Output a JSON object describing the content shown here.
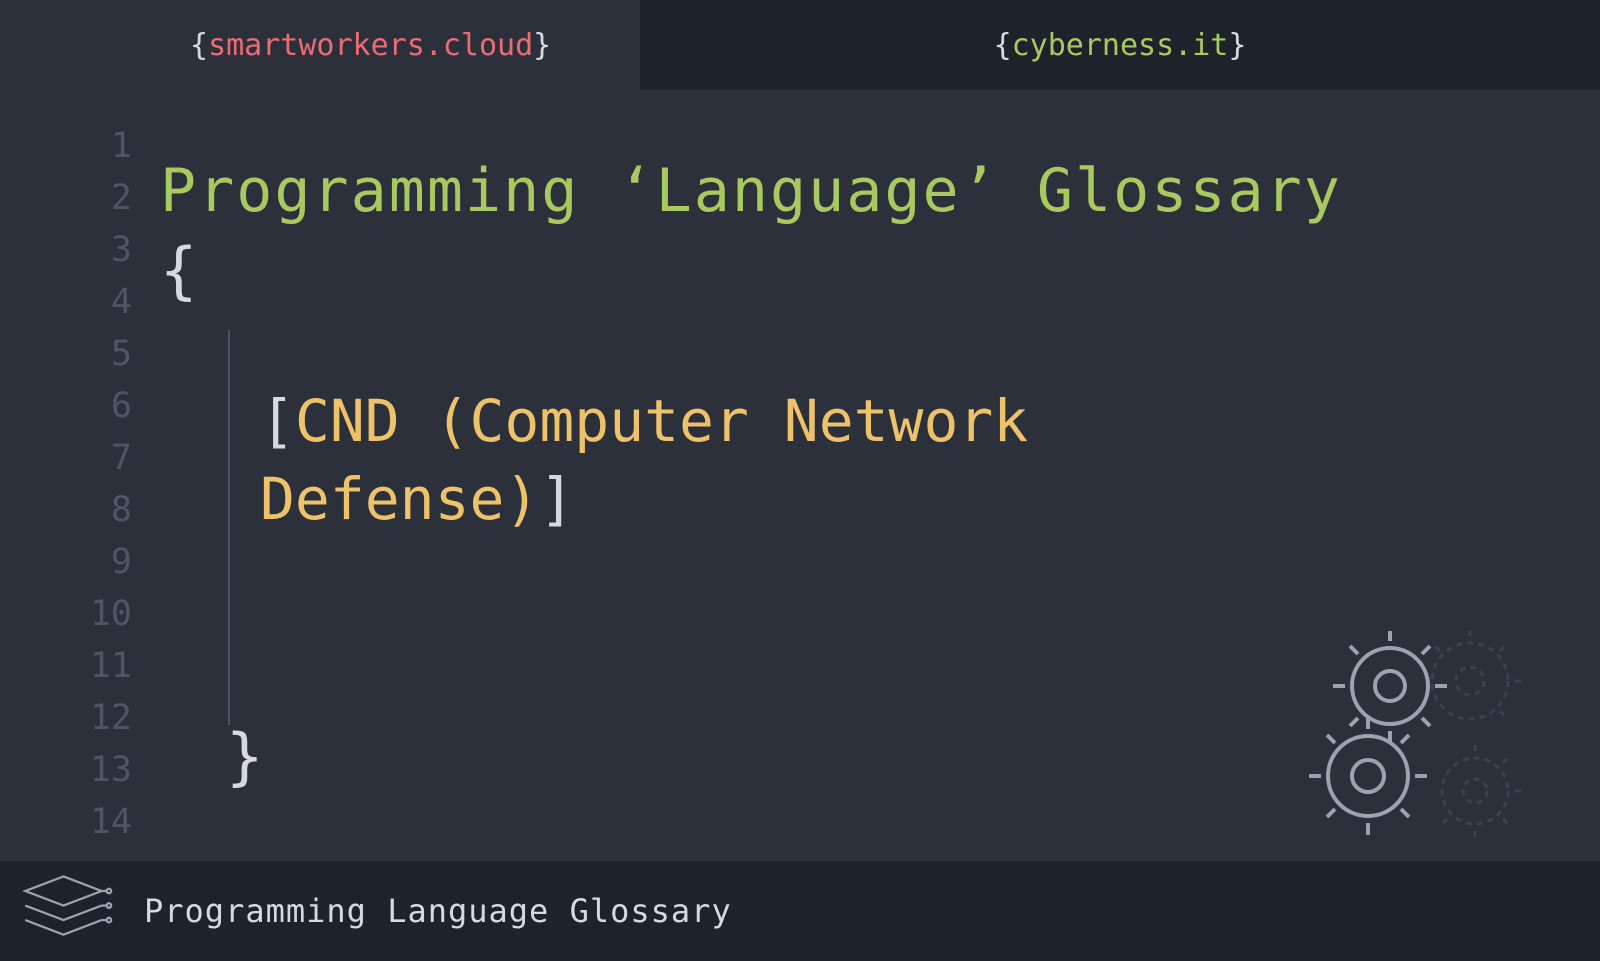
{
  "header": {
    "left_brand": "smartworkers.cloud",
    "right_brand": "cyberness.it",
    "brace_open": "{",
    "brace_close": "}"
  },
  "gutter": {
    "line_count": 14
  },
  "editor": {
    "title": "Programming ‘Language’ Glossary",
    "brace_open": "{",
    "brace_close": "}",
    "bracket_open": "[",
    "bracket_close": "]",
    "term": "CND (Computer Network Defense)"
  },
  "footer": {
    "text": "Programming Language Glossary"
  },
  "colors": {
    "bg": "#2b303b",
    "dark_bg": "#1e222b",
    "green": "#a8c95f",
    "red": "#ec6b75",
    "yellow": "#eec26a",
    "muted": "#4e5564",
    "white": "#d6dae0"
  }
}
